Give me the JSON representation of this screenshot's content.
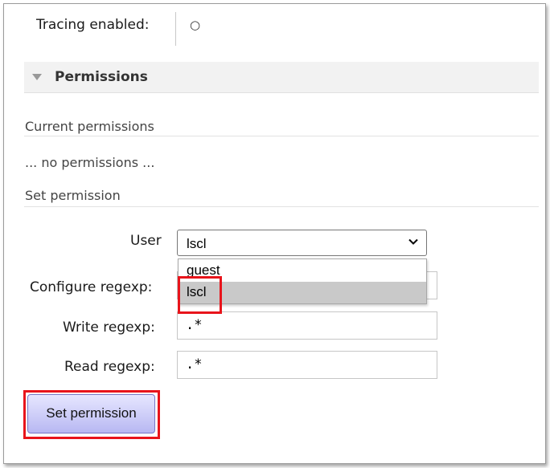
{
  "tracing": {
    "label": "Tracing enabled:",
    "value": "○"
  },
  "permissions_section": {
    "title": "Permissions",
    "current_heading": "Current permissions",
    "no_permissions": "... no permissions ...",
    "set_heading": "Set permission"
  },
  "form": {
    "user_label": "User",
    "user_selected": "lscl",
    "user_options": [
      "guest",
      "lscl"
    ],
    "configure_label": "Configure regexp:",
    "configure_value": ".*",
    "write_label": "Write regexp:",
    "write_value": ".*",
    "read_label": "Read regexp:",
    "read_value": ".*",
    "submit_label": "Set permission"
  },
  "colors": {
    "highlight_box": "#e8141b",
    "button_top": "#e6e6ff",
    "button_bottom": "#b8b8f2"
  }
}
